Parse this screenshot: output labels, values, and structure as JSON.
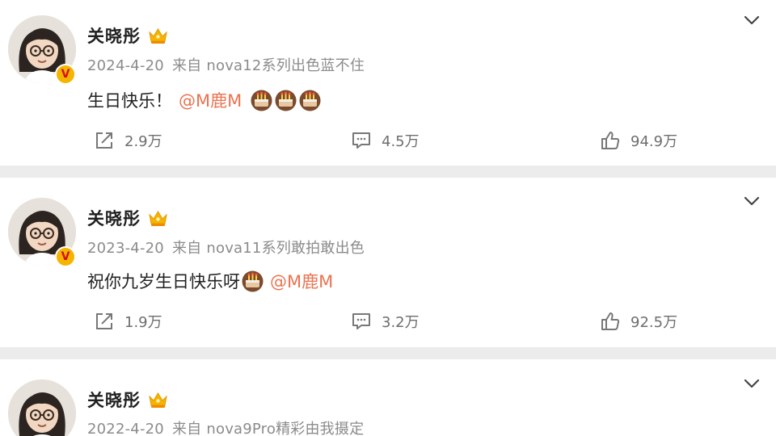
{
  "posts": [
    {
      "username": "关晓彤",
      "date": "2024-4-20",
      "source_prefix": "来自",
      "source": "nova12系列出色蓝不住",
      "text": "生日快乐！",
      "mention": "@M鹿M",
      "repost_count": "2.9万",
      "comment_count": "4.5万",
      "like_count": "94.9万"
    },
    {
      "username": "关晓彤",
      "date": "2023-4-20",
      "source_prefix": "来自",
      "source": "nova11系列敢拍敢出色",
      "text": "祝你九岁生日快乐呀",
      "mention": "@M鹿M",
      "repost_count": "1.9万",
      "comment_count": "3.2万",
      "like_count": "92.5万"
    },
    {
      "username": "关晓彤",
      "date": "2022-4-20",
      "source_prefix": "来自",
      "source": "nova9Pro精彩由我摄定"
    }
  ],
  "icons": {
    "verified": "verified-v-badge",
    "member": "crown-icon",
    "emoji": "birthday-cake-icon",
    "repost": "repost-icon",
    "comment": "comment-icon",
    "like": "thumbs-up-icon",
    "menu": "chevron-down-icon"
  },
  "colors": {
    "mention": "#eb7350",
    "badge": "#f5b400",
    "verified": "#d20f1b"
  },
  "verified_mark": "V"
}
